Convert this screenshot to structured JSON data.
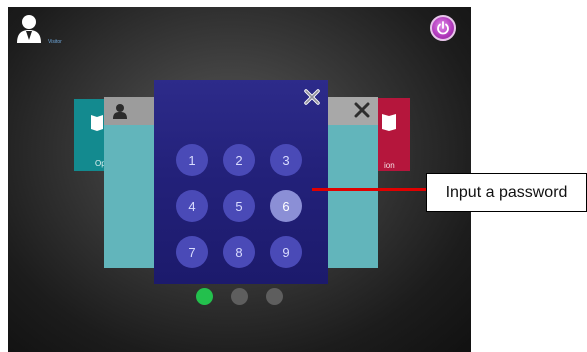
{
  "header": {
    "user_name": "Visitor"
  },
  "cards": {
    "left_label": "Op",
    "right_label": "ion"
  },
  "keypad": {
    "keys": [
      "1",
      "2",
      "3",
      "4",
      "5",
      "6",
      "7",
      "8",
      "9"
    ],
    "active_key": "6"
  },
  "pager": {
    "page_count": 3,
    "current_page": 1
  },
  "callout": {
    "text": "Input a password"
  },
  "colors": {
    "keypad_background": "#23217a",
    "key": "#4a4ab7",
    "key_active": "#8b8fd6",
    "power_button": "#b33cbe",
    "active_dot": "#23c04d",
    "left_card": "#138a8f",
    "right_card": "#b5163c",
    "callout_line": "#e00000"
  }
}
